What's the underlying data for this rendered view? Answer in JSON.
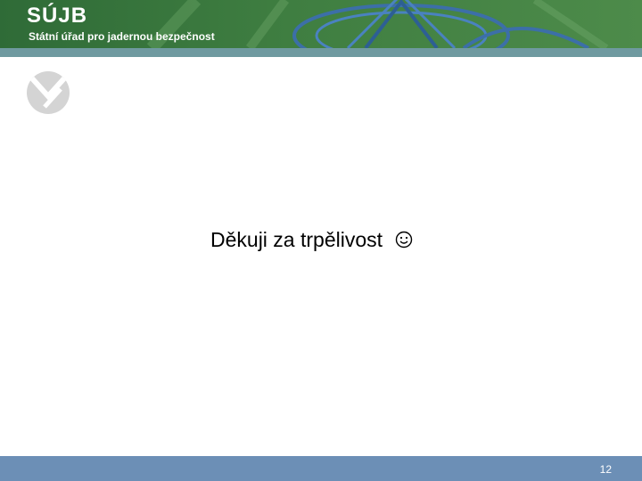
{
  "header": {
    "logo_text": "SÚJB",
    "subtitle": "Státní úřad pro jadernou bezpečnost"
  },
  "main": {
    "thanks_text": "Děkuji za trpělivost"
  },
  "footer": {
    "page_number": "12"
  },
  "icons": [
    "logo-mark-icon",
    "smiley-icon"
  ],
  "colors": {
    "header_green": "#3f7e41",
    "header_stripe": "#6f9aa0",
    "footer_blue": "#6c8fb6"
  }
}
